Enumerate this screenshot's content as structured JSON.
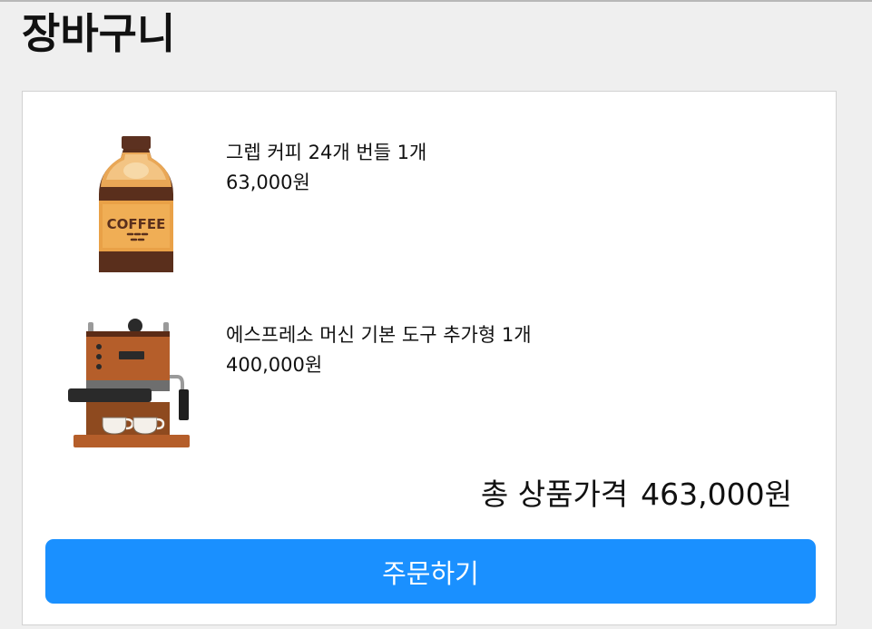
{
  "page": {
    "title": "장바구니"
  },
  "cart": {
    "items": [
      {
        "name": "그렙 커피 24개 번들 1개",
        "price": "63,000원",
        "icon": "coffee-bottle-icon",
        "image_label": "COFFEE"
      },
      {
        "name": "에스프레소 머신 기본 도구 추가형 1개",
        "price": "400,000원",
        "icon": "espresso-machine-icon"
      }
    ],
    "total_label": "총 상품가격",
    "total_value": "463,000원",
    "order_button_label": "주문하기"
  },
  "colors": {
    "accent": "#1a90ff",
    "background": "#efefef",
    "card": "#ffffff"
  }
}
